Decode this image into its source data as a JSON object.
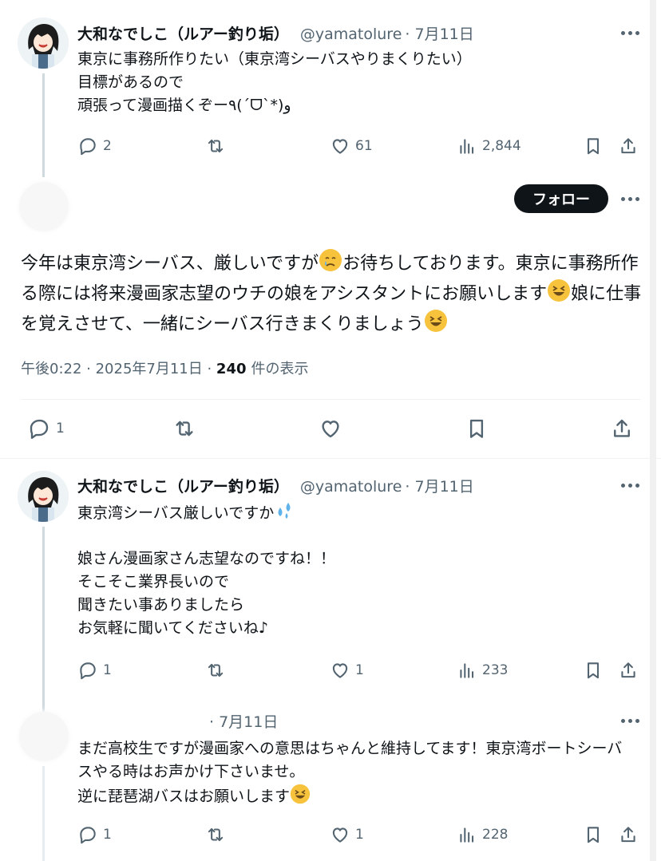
{
  "tweet1": {
    "name": "大和なでしこ（ルアー釣り垢）",
    "handle": "@yamatolure",
    "date": "· 7月11日",
    "text": "東京に事務所作りたい（東京湾シーバスやりまくりたい）\n目標があるので\n頑張って漫画描くぞー٩(ˊᗜˋ*)و",
    "replies": "2",
    "likes": "61",
    "views": "2,844"
  },
  "main": {
    "follow_label": "フォロー",
    "text_a": "今年は東京湾シーバス、厳しいですが",
    "text_b": "お待ちしております。東京に事務所作る際には将来漫画家志望のウチの娘をアシスタントにお願いします",
    "text_c": "娘に仕事を覚えさせて、一緒にシーバス行きまくりましょう",
    "time": "午後0:22 · 2025年7月11日 · ",
    "views_count": "240",
    "views_label": "件の表示",
    "replies": "1"
  },
  "tweet3": {
    "name": "大和なでしこ（ルアー釣り垢）",
    "handle": "@yamatolure",
    "date": "· 7月11日",
    "line1": "東京湾シーバス厳しいですか",
    "text": "娘さん漫画家さん志望なのですね！！\nそこそこ業界長いので\n聞きたい事ありましたら\nお気軽に聞いてくださいね♪",
    "replies": "1",
    "likes": "1",
    "views": "233"
  },
  "tweet4": {
    "date": "· 7月11日",
    "text_a": "まだ高校生ですが漫画家への意思はちゃんと維持してます！東京湾ボートシーバスやる時はお声かけ下さいませ。\n逆に琵琶湖バスはお願いします",
    "replies": "1",
    "likes": "1",
    "views": "228"
  }
}
